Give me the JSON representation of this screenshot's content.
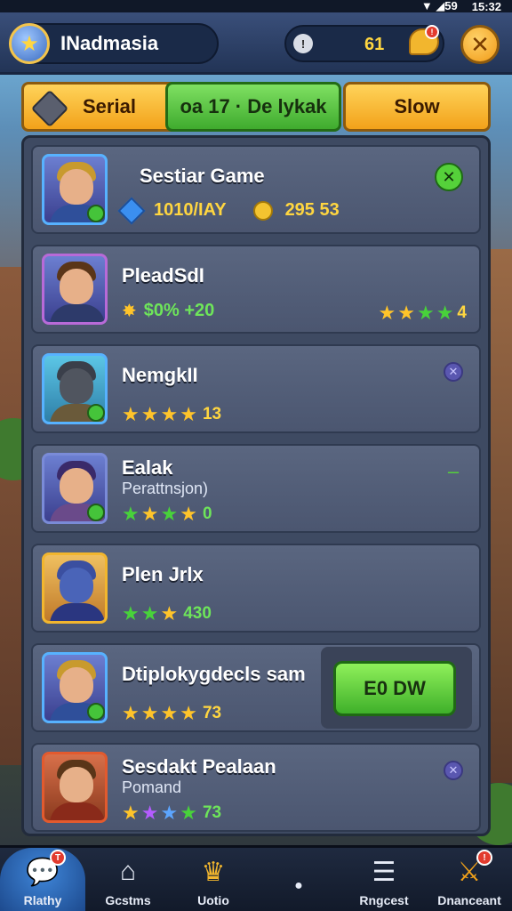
{
  "status_bar": {
    "signal": "▼ ◢59",
    "time": "15:32"
  },
  "header": {
    "player_name": "INadmasia",
    "currency_value": "61",
    "chat_badge": "!",
    "close_label": "✕"
  },
  "tabs": [
    {
      "label": "Serial"
    },
    {
      "label": "oa 17 · De lykak"
    },
    {
      "label": "Slow"
    }
  ],
  "rows": [
    {
      "title": "Sestiar Game",
      "gems": "1010/IAY",
      "coins": "295 53",
      "mark": "✕"
    },
    {
      "title": "PleadSdI",
      "stat": "$0% +20",
      "rating_count": "4"
    },
    {
      "title": "NemgkII",
      "rating_count": "13",
      "mark": "✕"
    },
    {
      "title": "Ealak",
      "subtitle": "Perattnsjon)",
      "rating_count": "0",
      "mark": "–"
    },
    {
      "title": "Plen Jrlx",
      "rating_count": "430"
    },
    {
      "title": "Dtiplokygdecls sam",
      "rating_count": "73",
      "action_label": "E0 DW"
    },
    {
      "title": "Sesdakt Pealaan",
      "subtitle": "Pomand",
      "rating_count": "73",
      "mark": "✕"
    }
  ],
  "bottom_nav": [
    {
      "label": "Rlathy",
      "icon": "chat-icon",
      "badge": "T",
      "active": true
    },
    {
      "label": "Gcstms",
      "icon": "home-icon"
    },
    {
      "label": "Uotio",
      "icon": "crown-icon"
    },
    {
      "label": "",
      "icon": "dot-icon"
    },
    {
      "label": "Rngcest",
      "icon": "menu-icon"
    },
    {
      "label": "Dnanceant",
      "icon": "swords-icon",
      "badge": "!"
    }
  ],
  "colors": {
    "accent_green": "#48d23a",
    "accent_orange": "#f2a21a",
    "panel": "#3e4a62",
    "star_gold": "#ffc42a"
  }
}
